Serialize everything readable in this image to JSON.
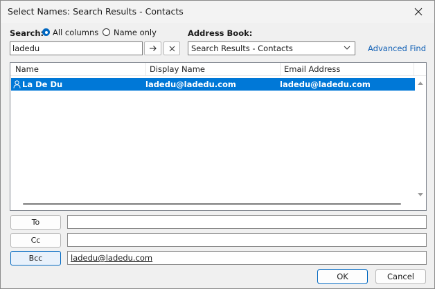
{
  "window": {
    "title": "Select Names: Search Results - Contacts"
  },
  "search": {
    "label": "Search:",
    "all_columns": "All columns",
    "name_only": "Name only",
    "query": "ladedu",
    "go_icon": "arrow-right-icon",
    "clear_icon": "close-icon"
  },
  "address_book": {
    "label": "Address Book:",
    "selected": "Search Results - Contacts",
    "advanced_find": "Advanced Find"
  },
  "table": {
    "headers": {
      "name": "Name",
      "display_name": "Display Name",
      "email": "Email Address"
    },
    "rows": [
      {
        "name": "La De Du",
        "display_name": "ladedu@ladedu.com",
        "email": "ladedu@ladedu.com",
        "icon": "person-icon"
      }
    ]
  },
  "recipients": {
    "to_label": "To",
    "to_value": "",
    "cc_label": "Cc",
    "cc_value": "",
    "bcc_label": "Bcc",
    "bcc_value": "ladedu@ladedu.com"
  },
  "buttons": {
    "ok": "OK",
    "cancel": "Cancel"
  },
  "colors": {
    "selection": "#0078d7",
    "accent": "#0067c0",
    "link": "#0f5fb5"
  }
}
